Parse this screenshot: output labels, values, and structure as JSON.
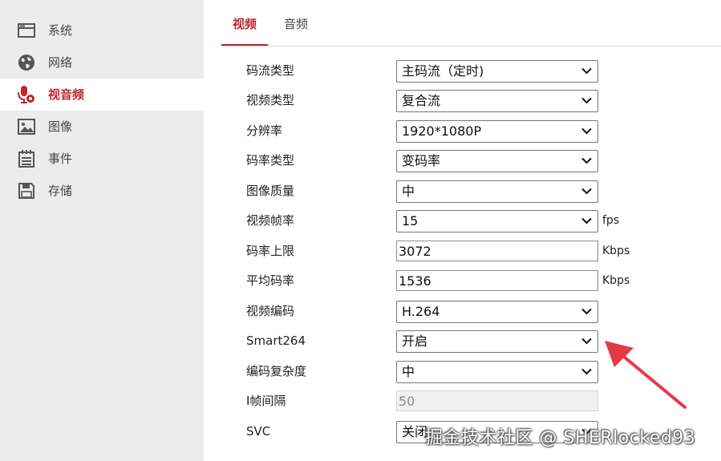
{
  "sidebar": {
    "items": [
      {
        "label": "系统",
        "icon": "window-icon",
        "active": false
      },
      {
        "label": "网络",
        "icon": "globe-icon",
        "active": false
      },
      {
        "label": "视音频",
        "icon": "microphone-icon",
        "active": true
      },
      {
        "label": "图像",
        "icon": "image-icon",
        "active": false
      },
      {
        "label": "事件",
        "icon": "calendar-icon",
        "active": false
      },
      {
        "label": "存储",
        "icon": "floppy-disk-icon",
        "active": false
      }
    ]
  },
  "tabs": [
    {
      "label": "视频",
      "active": true
    },
    {
      "label": "音频",
      "active": false
    }
  ],
  "form": {
    "stream_type": {
      "label": "码流类型",
      "value": "主码流（定时)"
    },
    "video_type": {
      "label": "视频类型",
      "value": "复合流"
    },
    "resolution": {
      "label": "分辨率",
      "value": "1920*1080P"
    },
    "bitrate_type": {
      "label": "码率类型",
      "value": "变码率"
    },
    "image_quality": {
      "label": "图像质量",
      "value": "中"
    },
    "frame_rate": {
      "label": "视频帧率",
      "value": "15",
      "unit": "fps"
    },
    "max_bitrate": {
      "label": "码率上限",
      "value": "3072",
      "unit": "Kbps"
    },
    "avg_bitrate": {
      "label": "平均码率",
      "value": "1536",
      "unit": "Kbps"
    },
    "video_encoding": {
      "label": "视频编码",
      "value": "H.264"
    },
    "smart264": {
      "label": "Smart264",
      "value": "开启"
    },
    "encoding_complexity": {
      "label": "编码复杂度",
      "value": "中"
    },
    "i_frame_interval": {
      "label": "I帧间隔",
      "value": "50"
    },
    "svc": {
      "label": "SVC",
      "value": "关闭"
    }
  },
  "watermark": "掘金技术社区 @ SHERlocked93",
  "colors": {
    "accent": "#c0262c",
    "sidebar_bg": "#ececec",
    "arrow": "#e53945"
  }
}
